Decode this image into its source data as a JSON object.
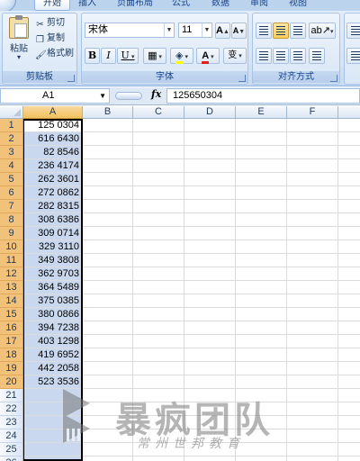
{
  "tabs": [
    {
      "label": "开始",
      "active": true
    },
    {
      "label": "插入"
    },
    {
      "label": "页面布局"
    },
    {
      "label": "公式"
    },
    {
      "label": "数据"
    },
    {
      "label": "审阅"
    },
    {
      "label": "视图"
    }
  ],
  "clipboard": {
    "paste": "粘贴",
    "cut": "剪切",
    "copy": "复制",
    "format_painter": "格式刷",
    "group_label": "剪贴板"
  },
  "font": {
    "name": "宋体",
    "size": "11",
    "group_label": "字体",
    "bold": "B",
    "italic": "I",
    "underline": "U",
    "grow": "A",
    "shrink": "A",
    "wen": "变"
  },
  "alignment": {
    "group_label": "对齐方式"
  },
  "formula_bar": {
    "name_box": "A1",
    "fx": "fx",
    "content": "125650304"
  },
  "columns": [
    "A",
    "B",
    "C",
    "D",
    "E",
    "F"
  ],
  "rows": [
    "1",
    "2",
    "3",
    "4",
    "5",
    "6",
    "7",
    "8",
    "9",
    "10",
    "11",
    "12",
    "13",
    "14",
    "15",
    "16",
    "17",
    "18",
    "19",
    "20",
    "21",
    "22",
    "23",
    "24",
    "25",
    "26"
  ],
  "cells_a": [
    "125  0304",
    "616  6430",
    "82  8546",
    "236  4174",
    "262  3601",
    "272  0862",
    "282  8315",
    "308  6386",
    "309  0714",
    "329  3110",
    "349  3808",
    "362  9703",
    "364  5489",
    "375  0385",
    "380  0866",
    "394  7238",
    "403  1298",
    "419  6952",
    "442  2058",
    "523  3536"
  ],
  "watermark": {
    "title": "暴疯团队",
    "subtitle": "常州世邦教育"
  },
  "colors": {
    "ribbon": "#d4e3f5",
    "row_header_selected": "#f3c27a",
    "selection": "#c9d8ee"
  }
}
